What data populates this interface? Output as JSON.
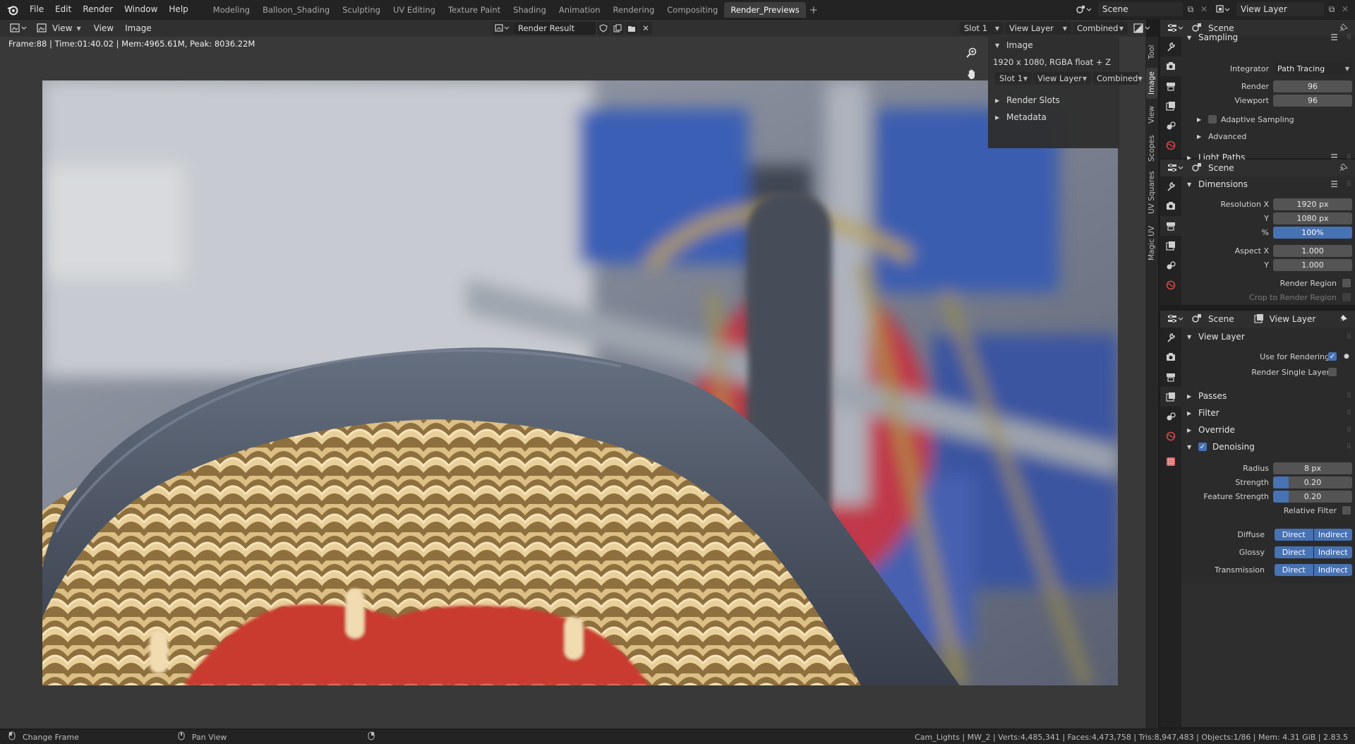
{
  "topbar": {
    "menus": [
      "File",
      "Edit",
      "Render",
      "Window",
      "Help"
    ],
    "workspaces": [
      "Modeling",
      "Balloon_Shading",
      "Sculpting",
      "UV Editing",
      "Texture Paint",
      "Shading",
      "Animation",
      "Rendering",
      "Compositing",
      "Render_Previews"
    ],
    "active_workspace": "Render_Previews",
    "scene_name": "Scene",
    "view_layer_name": "View Layer"
  },
  "editor": {
    "header": {
      "view_label": "View",
      "menu_view": "View",
      "menu_image": "Image",
      "image_name": "Render Result",
      "slot": "Slot 1",
      "layer": "View Layer",
      "pass": "Combined"
    },
    "frame_info": "Frame:88 | Time:01:40.02 | Mem:4965.61M, Peak: 8036.22M",
    "npanel": {
      "image_section": "Image",
      "image_info": "1920 x 1080,  RGBA float + Z",
      "slot": "Slot 1",
      "layer": "View Layer",
      "pass": "Combined",
      "render_slots": "Render Slots",
      "metadata": "Metadata"
    },
    "vertical_tabs": [
      "Tool",
      "Image",
      "View",
      "Scopes",
      "UV Squares",
      "Magic UV"
    ],
    "active_vtab": "Image"
  },
  "render_props": {
    "header_title": "Scene",
    "section_sampling": "Sampling",
    "integrator_label": "Integrator",
    "integrator_value": "Path Tracing",
    "render_label": "Render",
    "render_value": "96",
    "viewport_label": "Viewport",
    "viewport_value": "96",
    "adaptive_sampling": "Adaptive Sampling",
    "advanced": "Advanced",
    "light_paths": "Light Paths"
  },
  "output_props": {
    "header_title": "Scene",
    "section_dimensions": "Dimensions",
    "resolution_x_label": "Resolution X",
    "resolution_x_value": "1920 px",
    "resolution_y_label": "Y",
    "resolution_y_value": "1080 px",
    "percent_label": "%",
    "percent_value": "100%",
    "aspect_x_label": "Aspect X",
    "aspect_x_value": "1.000",
    "aspect_y_label": "Y",
    "aspect_y_value": "1.000",
    "render_region": "Render Region",
    "crop_region": "Crop to Render Region"
  },
  "viewlayer_props": {
    "header_scene": "Scene",
    "header_layer": "View Layer",
    "section_view_layer": "View Layer",
    "use_for_rendering": "Use for Rendering",
    "render_single_layer": "Render Single Layer",
    "passes": "Passes",
    "filter": "Filter",
    "override": "Override",
    "denoising": "Denoising",
    "radius_label": "Radius",
    "radius_value": "8 px",
    "strength_label": "Strength",
    "strength_value": "0.20",
    "strength_fraction": 0.2,
    "feature_strength_label": "Feature Strength",
    "feature_strength_value": "0.20",
    "feature_strength_fraction": 0.2,
    "relative_filter": "Relative Filter",
    "diffuse_label": "Diffuse",
    "glossy_label": "Glossy",
    "transmission_label": "Transmission",
    "direct": "Direct",
    "indirect": "Indirect"
  },
  "statusbar": {
    "left_action": "Change Frame",
    "middle_action": "Pan View",
    "stats": "Cam_Lights | MW_2 | Verts:4,485,341 | Faces:4,473,758 | Tris:8,947,483 | Objects:1/86 | Mem: 4.31 GiB | 2.83.5"
  },
  "colors": {
    "accent_blue": "#4772b3",
    "header_bg": "#303030",
    "panel_bg": "#2b2b2b"
  }
}
